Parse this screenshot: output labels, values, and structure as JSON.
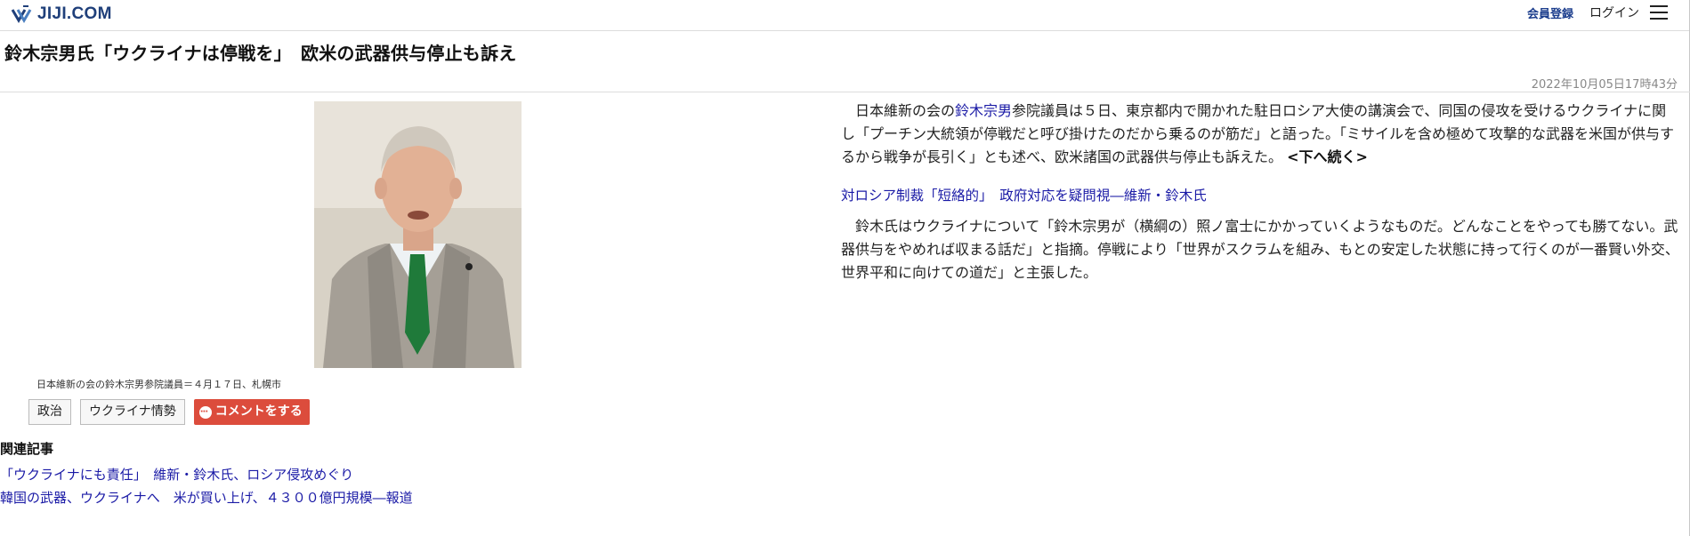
{
  "header": {
    "logo_text": "JIJI.COM",
    "member_register": "会員登録",
    "login": "ログイン"
  },
  "article": {
    "title": "鈴木宗男氏「ウクライナは停戦を」　欧米の武器供与停止も訴え",
    "date": "2022年10月05日17時43分",
    "para1_before": "日本維新の会の",
    "para1_link": "鈴木宗男",
    "para1_after": "参院議員は５日、東京都内で開かれた駐日ロシア大使の講演会で、同国の侵攻を受けるウクライナに関し「プーチン大統領が停戦だと呼び掛けたのだから乗るのが筋だ」と語った。「ミサイルを含め極めて攻撃的な武器を米国が供与するから戦争が長引く」とも述べ、欧米諸国の武器供与停止も訴えた。",
    "more": "<下へ続く>",
    "mid_link": "対ロシア制裁「短絡的」　政府対応を疑問視―維新・鈴木氏",
    "para2": "鈴木氏はウクライナについて「鈴木宗男が（横綱の）照ノ富士にかかっていくようなものだ。どんなことをやっても勝てない。武器供与をやめれば収まる話だ」と指摘。停戦により「世界がスクラムを組み、もとの安定した状態に持って行くのが一番賢い外交、世界平和に向けての道だ」と主張した。"
  },
  "photo": {
    "caption": "日本維新の会の鈴木宗男参院議員＝４月１７日、札幌市"
  },
  "tags": {
    "tag1": "政治",
    "tag2": "ウクライナ情勢",
    "comment": "コメントをする"
  },
  "related": {
    "heading": "関連記事",
    "links": [
      "「ウクライナにも責任」　維新・鈴木氏、ロシア侵攻めぐり",
      "韓国の武器、ウクライナへ　米が買い上げ、４３００億円規模―報道"
    ]
  },
  "colors": {
    "link": "#1a1aa6",
    "brand": "#1f3f7a",
    "comment_button": "#dc4c3c"
  }
}
